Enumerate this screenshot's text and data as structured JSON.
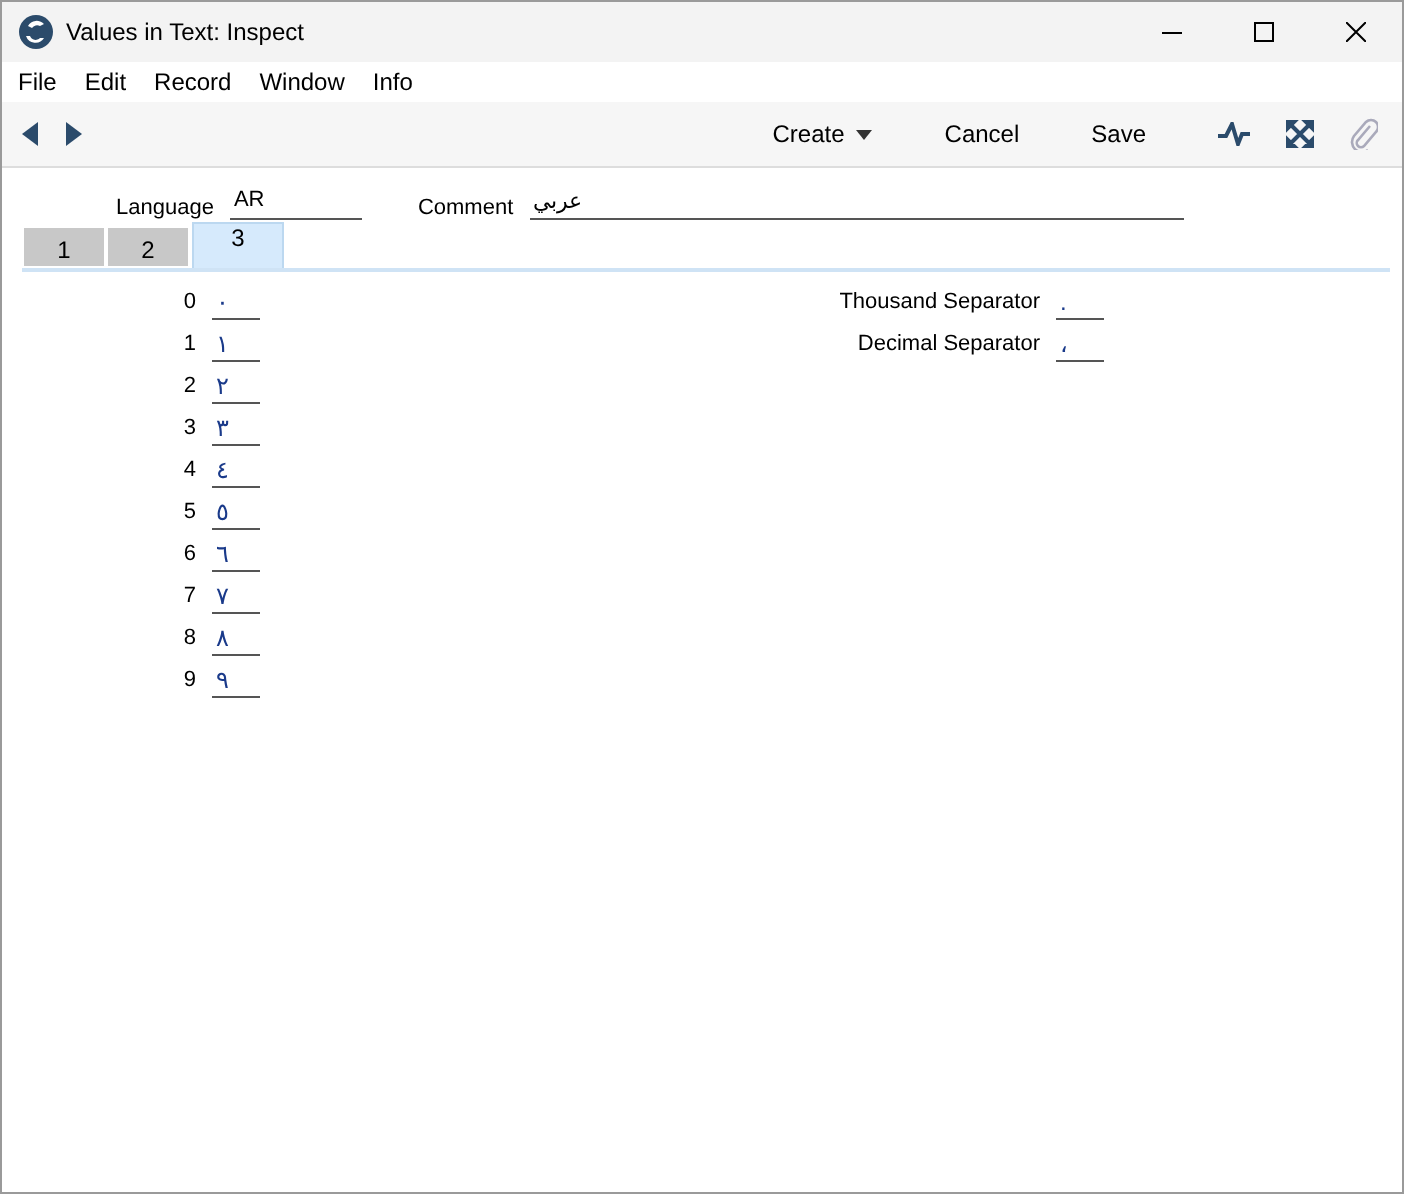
{
  "window": {
    "title": "Values in Text: Inspect"
  },
  "menu": [
    "File",
    "Edit",
    "Record",
    "Window",
    "Info"
  ],
  "toolbar": {
    "buttons": [
      {
        "label": "Create",
        "kind": "dropdown"
      },
      {
        "label": "Cancel",
        "kind": "plain"
      },
      {
        "label": "Save",
        "kind": "plain"
      }
    ],
    "attach_disabled": true
  },
  "header": {
    "language": {
      "label": "Language",
      "value": "AR"
    },
    "comment": {
      "label": "Comment",
      "value": "عربي"
    }
  },
  "tabs": [
    {
      "label": "1",
      "selected": false
    },
    {
      "label": "2",
      "selected": false
    },
    {
      "label": "3",
      "selected": true
    }
  ],
  "digits": [
    {
      "label": "0",
      "value": "٠"
    },
    {
      "label": "1",
      "value": "١"
    },
    {
      "label": "2",
      "value": "٢"
    },
    {
      "label": "3",
      "value": "٣"
    },
    {
      "label": "4",
      "value": "٤"
    },
    {
      "label": "5",
      "value": "٥"
    },
    {
      "label": "6",
      "value": "٦"
    },
    {
      "label": "7",
      "value": "٧"
    },
    {
      "label": "8",
      "value": "٨"
    },
    {
      "label": "9",
      "value": "٩"
    }
  ],
  "separators": [
    {
      "label": "Thousand Separator",
      "value": "."
    },
    {
      "label": "Decimal Separator",
      "value": "،"
    }
  ]
}
